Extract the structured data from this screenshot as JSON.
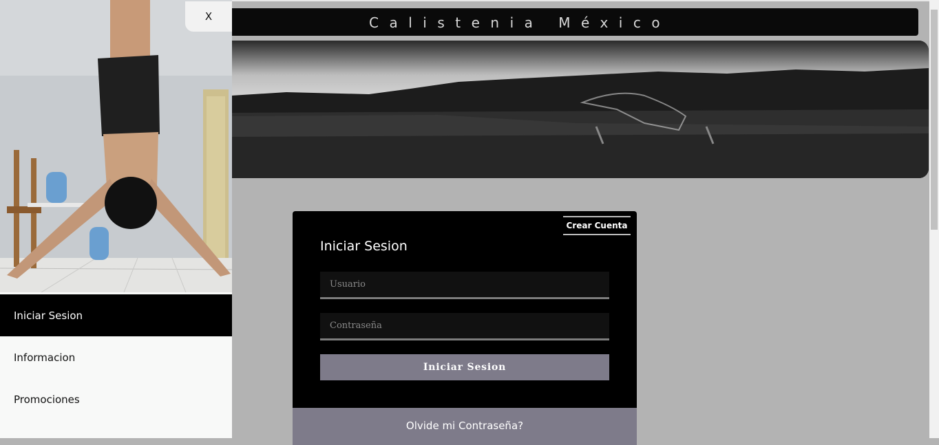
{
  "header": {
    "title": "Calistenia México"
  },
  "drawer": {
    "close_label": "X",
    "items": [
      {
        "label": "Iniciar Sesion",
        "active": true
      },
      {
        "label": "Informacion",
        "active": false
      },
      {
        "label": "Promociones",
        "active": false
      }
    ]
  },
  "login": {
    "create_account_label": "Crear Cuenta",
    "title": "Iniciar Sesion",
    "username_placeholder": "Usuario",
    "password_placeholder": "Contraseña",
    "submit_label": "Iniciar Sesion",
    "forgot_label": "Olvide mi Contraseña?"
  },
  "colors": {
    "accent": "#7e7b8a",
    "background": "#b3b3b3",
    "card": "#000000"
  }
}
